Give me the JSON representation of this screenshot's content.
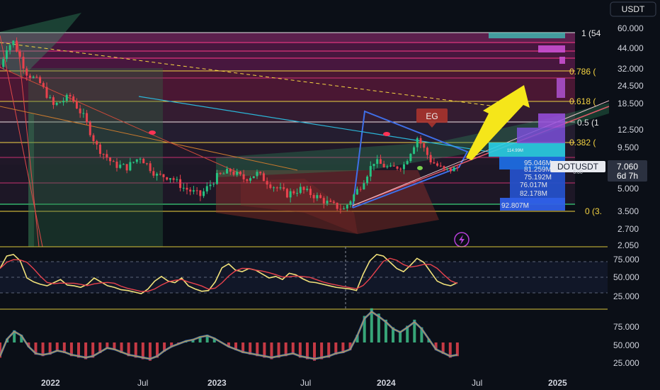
{
  "currency_badge": "USDT",
  "time_axis": {
    "labels": [
      {
        "text": "2022",
        "bold": true
      },
      {
        "text": "Jul",
        "bold": false
      },
      {
        "text": "2023",
        "bold": true
      },
      {
        "text": "Jul",
        "bold": false
      },
      {
        "text": "2024",
        "bold": true
      },
      {
        "text": "Jul",
        "bold": false
      },
      {
        "text": "2025",
        "bold": true
      }
    ]
  },
  "price_axis_labels": [
    "60.000",
    "44.000",
    "32.000",
    "24.500",
    "18.500",
    "12.500",
    "9.500",
    "5.000",
    "3.500",
    "2.700",
    "2.050"
  ],
  "rsi_axis_labels": [
    "75.000",
    "50.000",
    "25.000"
  ],
  "osc_axis_labels": [
    "75.000",
    "50.000",
    "25.000"
  ],
  "fib_levels": [
    {
      "label": "1 (54",
      "color": "#e6e6e6",
      "price": 54
    },
    {
      "label": "0.786 (",
      "color": "#f5d442",
      "price": 30
    },
    {
      "label": "0.618 (",
      "color": "#f5d442",
      "price": 19
    },
    {
      "label": "0.5 (1",
      "color": "#e6e6e6",
      "price": 14
    },
    {
      "label": "0.382 (",
      "color": "#f5d442",
      "price": 10.3
    },
    {
      "label": "0 (3.",
      "color": "#f5d442",
      "price": 3.55
    }
  ],
  "pattern_label": "EG",
  "volume_profile_labels": [
    "114.99M",
    "95.046M",
    "81.259M",
    "75.192M",
    "76.017M",
    "82.178M",
    "92.807M"
  ],
  "ticker": {
    "symbol": "DOTUSDT",
    "price": "7.060",
    "countdown": "6d 7h",
    "partial": "6.00"
  },
  "chart_data": {
    "type": "candlestick",
    "symbol": "DOTUSDT",
    "interval": "1W",
    "x_range": [
      "2021-10-18",
      "2025-04-14"
    ],
    "y_scale": "log",
    "y_range": [
      2.05,
      72
    ],
    "last_price": 7.06,
    "price_path": [
      [
        "2021-10-18",
        35
      ],
      [
        "2021-11-01",
        48
      ],
      [
        "2021-11-15",
        52
      ],
      [
        "2021-12-13",
        32
      ],
      [
        "2022-01-10",
        27
      ],
      [
        "2022-02-07",
        19
      ],
      [
        "2022-03-14",
        22
      ],
      [
        "2022-04-11",
        16
      ],
      [
        "2022-05-09",
        10
      ],
      [
        "2022-06-13",
        7.5
      ],
      [
        "2022-07-11",
        7.2
      ],
      [
        "2022-08-08",
        8.5
      ],
      [
        "2022-09-12",
        6.3
      ],
      [
        "2022-10-10",
        6.2
      ],
      [
        "2022-11-07",
        5.2
      ],
      [
        "2022-12-12",
        4.6
      ],
      [
        "2023-01-16",
        6.2
      ],
      [
        "2023-02-13",
        6.8
      ],
      [
        "2023-03-13",
        6.0
      ],
      [
        "2023-04-10",
        6.5
      ],
      [
        "2023-05-08",
        5.5
      ],
      [
        "2023-06-12",
        4.7
      ],
      [
        "2023-07-10",
        5.1
      ],
      [
        "2023-08-14",
        4.5
      ],
      [
        "2023-09-11",
        4.0
      ],
      [
        "2023-10-09",
        3.7
      ],
      [
        "2023-10-23",
        4.3
      ],
      [
        "2023-11-13",
        5.4
      ],
      [
        "2023-12-11",
        7.9
      ],
      [
        "2024-01-15",
        7.0
      ],
      [
        "2024-02-12",
        7.5
      ],
      [
        "2024-03-11",
        11.5
      ],
      [
        "2024-04-08",
        8.0
      ],
      [
        "2024-05-06",
        6.8
      ],
      [
        "2024-06-03",
        7.06
      ]
    ],
    "rsi": {
      "axis_labels": [
        75,
        50,
        25
      ],
      "ylim": [
        12,
        88
      ],
      "band": [
        30,
        70
      ],
      "start": "2021-10-18",
      "end": "2024-06-03",
      "values": [
        62,
        78,
        80,
        72,
        50,
        45,
        42,
        40,
        44,
        48,
        41,
        40,
        38,
        42,
        50,
        45,
        40,
        38,
        35,
        34,
        32,
        30,
        36,
        46,
        52,
        46,
        44,
        50,
        40,
        36,
        33,
        34,
        45,
        63,
        68,
        60,
        58,
        62,
        60,
        55,
        50,
        52,
        48,
        56,
        54,
        49,
        45,
        44,
        42,
        40,
        38,
        37,
        36,
        34,
        55,
        72,
        80,
        78,
        70,
        62,
        58,
        66,
        75,
        70,
        58,
        46,
        42,
        40,
        44
      ]
    },
    "oscillator": {
      "axis_labels": [
        75,
        50,
        25
      ],
      "ylim": [
        8,
        92
      ],
      "start": "2021-10-18",
      "end": "2024-06-03",
      "histogram": [
        30,
        55,
        66,
        60,
        44,
        34,
        32,
        34,
        38,
        36,
        32,
        30,
        28,
        30,
        36,
        42,
        40,
        36,
        32,
        30,
        28,
        26,
        30,
        38,
        44,
        48,
        52,
        54,
        58,
        60,
        56,
        50,
        44,
        40,
        36,
        34,
        32,
        30,
        28,
        30,
        32,
        34,
        30,
        28,
        26,
        28,
        30,
        34,
        36,
        40,
        60,
        85,
        95,
        88,
        80,
        70,
        65,
        72,
        80,
        70,
        55,
        40,
        35,
        30,
        32
      ]
    }
  }
}
